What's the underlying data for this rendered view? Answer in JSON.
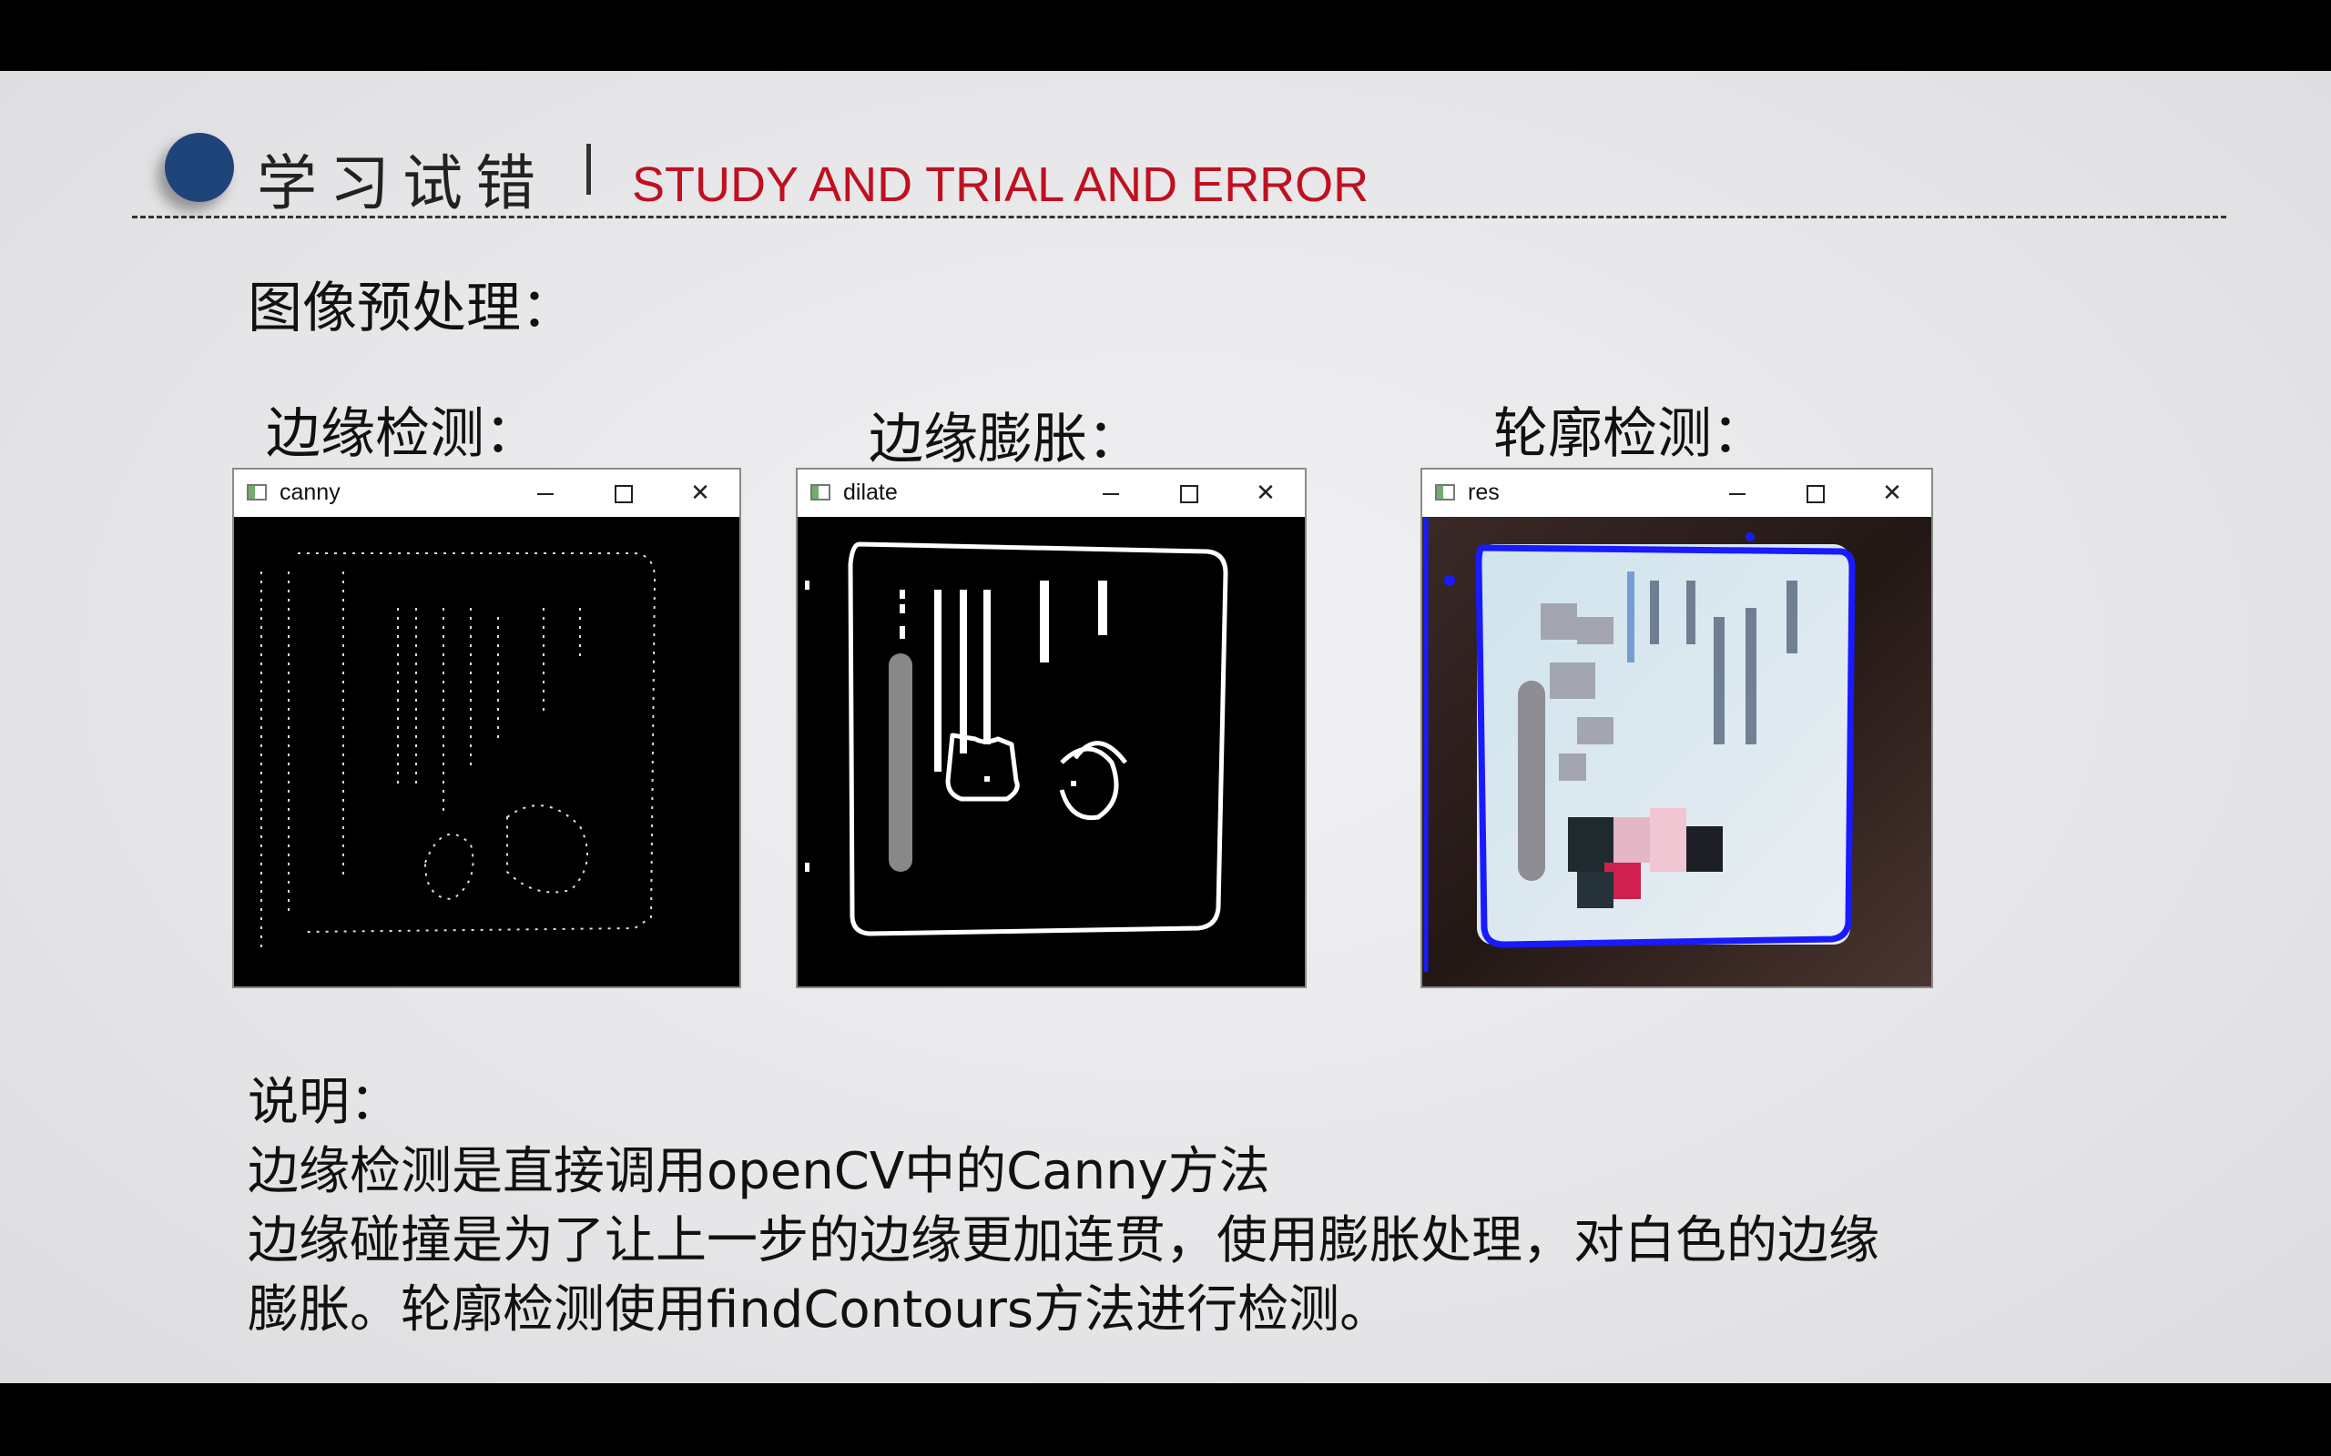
{
  "slide": {
    "title_cn": "学习试错",
    "title_en": "STUDY AND TRIAL AND ERROR",
    "section_heading": "图像预处理：",
    "captions": {
      "edge": "边缘检测：",
      "dilate": "边缘膨胀：",
      "contour": "轮廓检测："
    },
    "description": {
      "label": "说明：",
      "line1": "边缘检测是直接调用openCV中的Canny方法",
      "line2": "边缘碰撞是为了让上一步的边缘更加连贯，使用膨胀处理，对白色的边缘",
      "line3": "膨胀。轮廓检测使用findContours方法进行检测。"
    }
  },
  "windows": [
    {
      "title": "canny",
      "icon": "app-icon",
      "controls": {
        "minimize": "—",
        "maximize": "☐",
        "close": "✕"
      }
    },
    {
      "title": "dilate",
      "icon": "app-icon",
      "controls": {
        "minimize": "—",
        "maximize": "☐",
        "close": "✕"
      }
    },
    {
      "title": "res",
      "icon": "app-icon",
      "controls": {
        "minimize": "—",
        "maximize": "☐",
        "close": "✕"
      }
    }
  ],
  "colors": {
    "accent_dot": "#1f4479",
    "title_en": "#c0101f",
    "contour_line": "#1a1aff"
  }
}
